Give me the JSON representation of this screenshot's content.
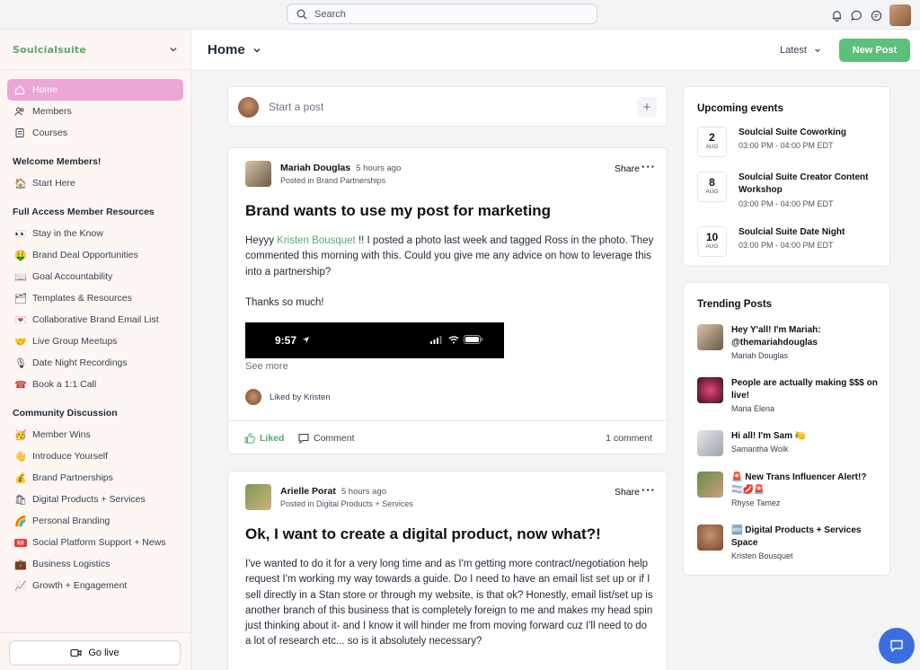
{
  "topbar": {
    "search_placeholder": "Search",
    "icons": [
      "bell-icon",
      "chat-icon",
      "message-icon"
    ]
  },
  "sidebar": {
    "logo": "Soulcialsuite",
    "main_nav": [
      {
        "label": "Home",
        "icon": "home-icon",
        "active": true
      },
      {
        "label": "Members",
        "icon": "members-icon"
      },
      {
        "label": "Courses",
        "icon": "courses-icon"
      }
    ],
    "sections": [
      {
        "title": "Welcome Members!",
        "items": [
          {
            "emoji": "🏠",
            "label": "Start Here"
          }
        ]
      },
      {
        "title": "Full Access Member Resources",
        "items": [
          {
            "emoji": "👀",
            "label": "Stay in the Know"
          },
          {
            "emoji": "🤑",
            "label": "Brand Deal Opportunities"
          },
          {
            "emoji": "📖",
            "label": "Goal Accountability"
          },
          {
            "emoji": "🗂",
            "label": "Templates & Resources"
          },
          {
            "emoji": "💌",
            "label": "Collaborative Brand Email List"
          },
          {
            "emoji": "🤝",
            "label": "Live Group Meetups"
          },
          {
            "emoji": "🎙",
            "label": "Date Night Recordings"
          },
          {
            "emoji": "☎",
            "label": "Book a 1:1 Call"
          }
        ]
      },
      {
        "title": "Community Discussion",
        "items": [
          {
            "emoji": "🥳",
            "label": "Member Wins"
          },
          {
            "emoji": "👋",
            "label": "Introduce Yourself"
          },
          {
            "emoji": "💰",
            "label": "Brand Partnerships"
          },
          {
            "emoji": "🛍",
            "label": "Digital Products + Services"
          },
          {
            "emoji": "🌈",
            "label": "Personal Branding"
          },
          {
            "emoji": "🆘",
            "label": "Social Platform Support + News"
          },
          {
            "emoji": "💼",
            "label": "Business Logistics"
          },
          {
            "emoji": "📈",
            "label": "Growth + Engagement"
          }
        ]
      }
    ],
    "go_live": "Go live"
  },
  "header": {
    "title": "Home",
    "sort": "Latest",
    "new_post": "New Post"
  },
  "start_post": {
    "placeholder": "Start a post"
  },
  "posts": [
    {
      "author": "Mariah Douglas",
      "time": "5 hours ago",
      "posted_in": "Posted in Brand Partnerships",
      "share": "Share",
      "title": "Brand wants to use my post for marketing",
      "body_pre": "Heyyy ",
      "mention": "Kristen Bousquet",
      "body_post": " !! I posted a photo last week and tagged Ross in the photo. They commented this morning with this. Could you give me any advice on how to leverage this into a partnership?",
      "body_2": "Thanks so much!",
      "image_time": "9:57",
      "see_more": "See more",
      "liked_by": "Liked by Kristen",
      "liked": "Liked",
      "comment": "Comment",
      "comments_count": "1 comment"
    },
    {
      "author": "Arielle Porat",
      "time": "5 hours ago",
      "posted_in": "Posted in Digital Products + Services",
      "share": "Share",
      "title": "Ok, I want to create a digital product, now what?!",
      "body": "I've wanted to do it for a very long time and as I'm getting more contract/negotiation help request I'm working my way towards a guide. Do I need to have an email list set up or if I sell directly in a Stan store or through my website, is that ok? Honestly, email list/set up is another branch of this business that is completely foreign to me and makes my head spin just thinking about it- and I know it will hinder me from moving forward cuz I'll need to do a lot of research etc... so is it absolutely necessary?"
    }
  ],
  "events": {
    "title": "Upcoming events",
    "items": [
      {
        "day": "2",
        "month": "AUG",
        "name": "Soulcial Suite Coworking",
        "time": "03:00 PM - 04:00 PM EDT"
      },
      {
        "day": "8",
        "month": "AUG",
        "name": "Soulcial Suite Creator Content Workshop",
        "time": "03:00 PM - 04:00 PM EDT"
      },
      {
        "day": "10",
        "month": "AUG",
        "name": "Soulcial Suite Date Night",
        "time": "03:00 PM - 04:00 PM EDT"
      }
    ]
  },
  "trending": {
    "title": "Trending Posts",
    "items": [
      {
        "title": "Hey Y'all! I'm Mariah: @themariahdouglas",
        "author": "Mariah Douglas"
      },
      {
        "title": "People are actually making $$$ on live!",
        "author": "Maria Elena"
      },
      {
        "title": "Hi all! I'm Sam 🍋",
        "author": "Samantha Wolk"
      },
      {
        "title": "🚨 New Trans Influencer Alert!? 🏳️‍⚧️💋🚨",
        "author": "Rhyse Tamez"
      },
      {
        "title": "🆕 Digital Products + Services Space",
        "author": "Kristen Bousquet"
      }
    ]
  },
  "colors": {
    "accent": "#5cbf7a",
    "active_nav": "#eca7d6",
    "chat": "#3b6fe0"
  }
}
